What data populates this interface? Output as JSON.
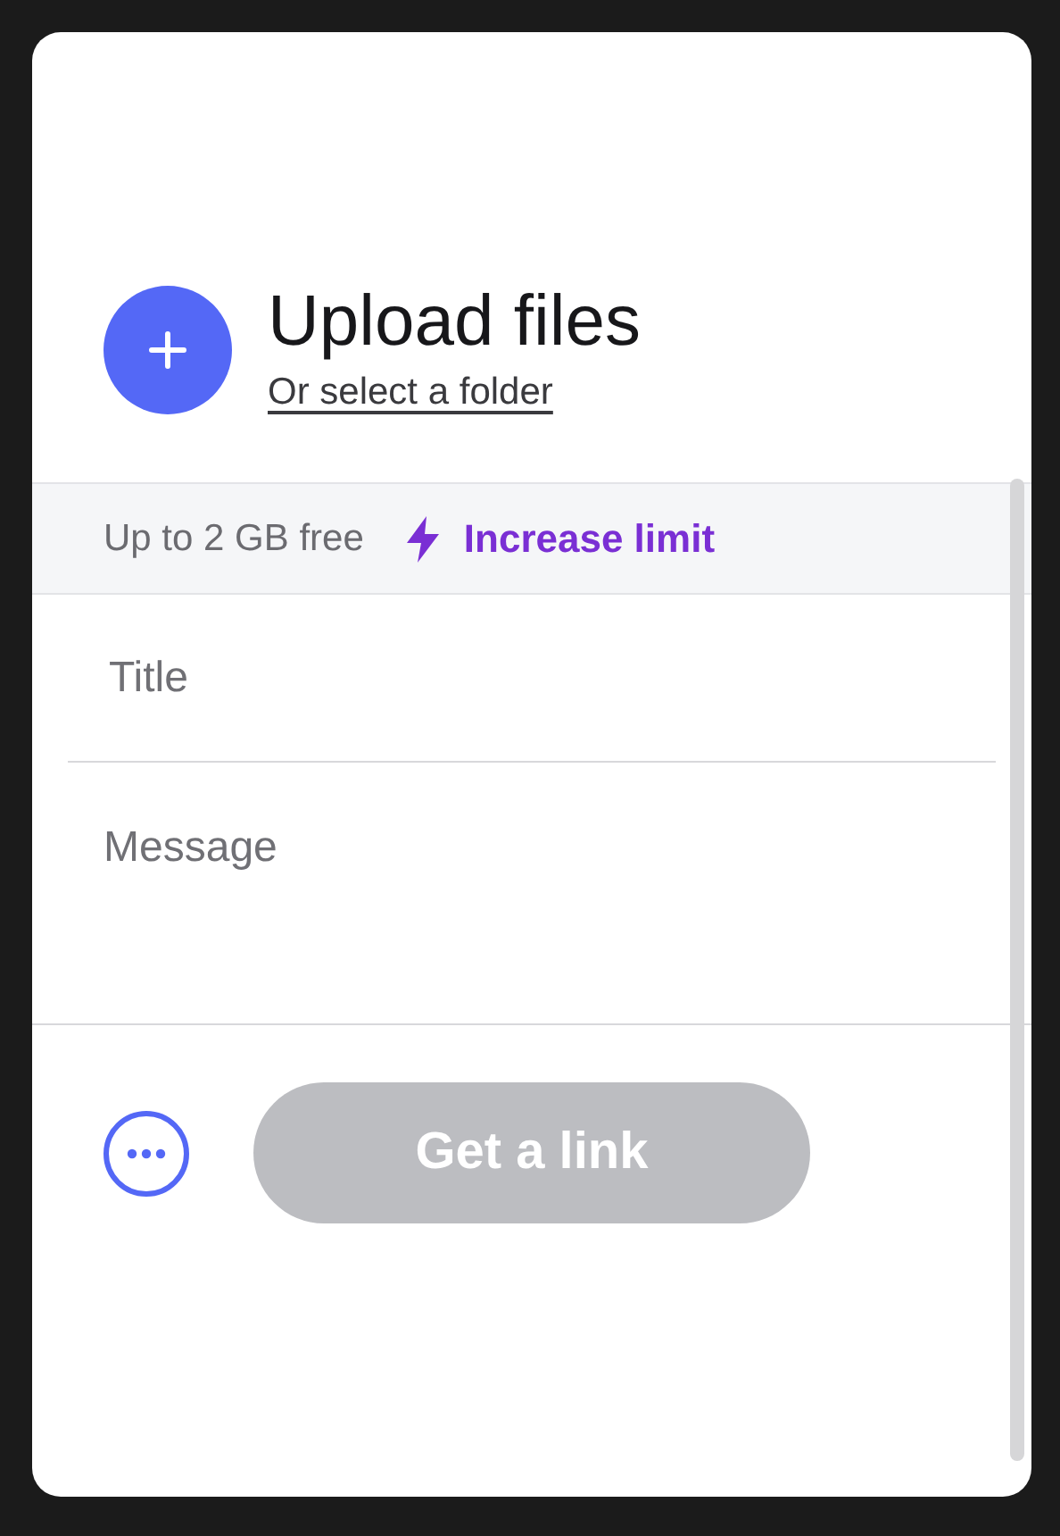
{
  "upload": {
    "title": "Upload files",
    "link": "Or select a folder"
  },
  "limit": {
    "text": "Up to 2 GB free",
    "link": "Increase limit"
  },
  "form": {
    "title": {
      "placeholder": "Title"
    },
    "message": {
      "placeholder": "Message"
    }
  },
  "footer": {
    "button": {
      "label": "Get a link",
      "disabled": true
    }
  }
}
